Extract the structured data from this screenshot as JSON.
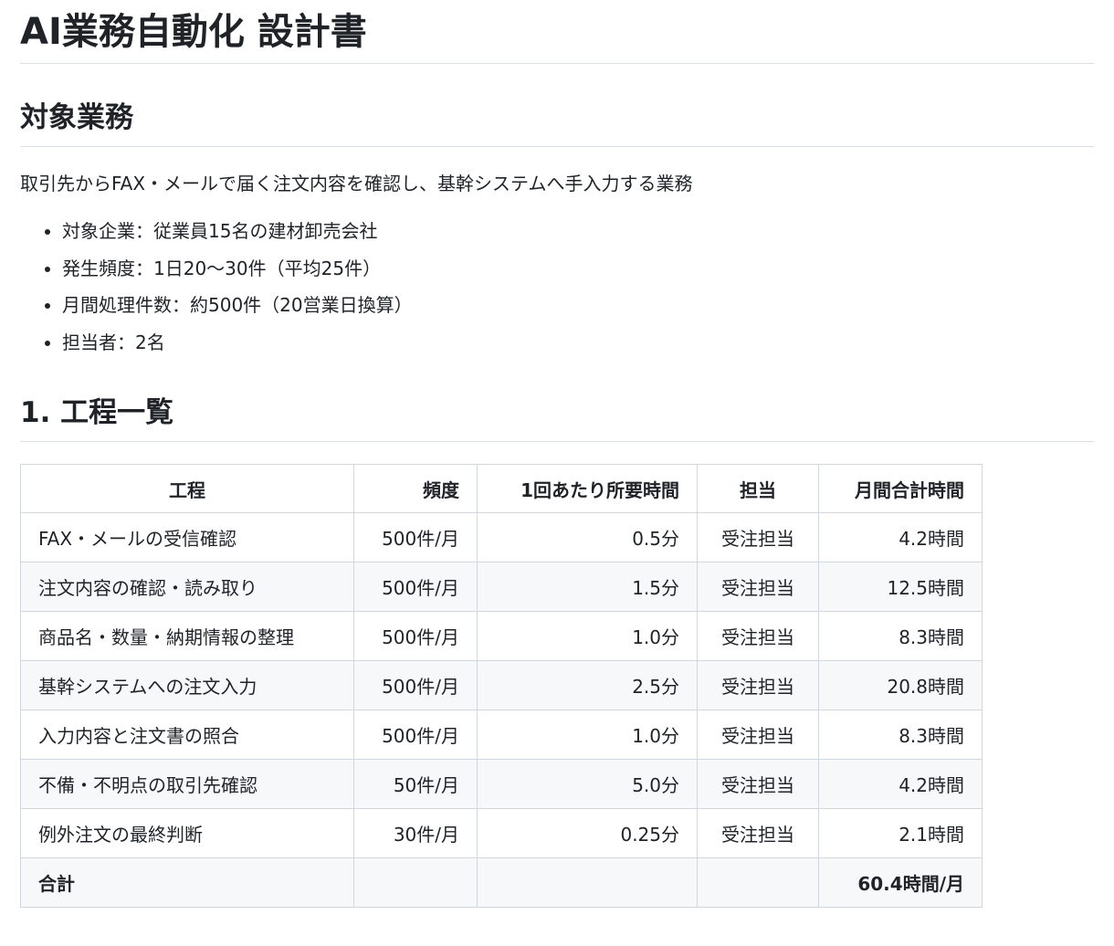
{
  "document": {
    "title": "AI業務自動化 設計書",
    "section_target": {
      "heading": "対象業務",
      "description": "取引先からFAX・メールで届く注文内容を確認し、基幹システムへ手入力する業務",
      "bullets": [
        "対象企業：従業員15名の建材卸売会社",
        "発生頻度：1日20〜30件（平均25件）",
        "月間処理件数：約500件（20営業日換算）",
        "担当者：2名"
      ]
    },
    "section_process": {
      "heading": "1. 工程一覧",
      "table": {
        "headers": [
          "工程",
          "頻度",
          "1回あたり所要時間",
          "担当",
          "月間合計時間"
        ],
        "rows": [
          [
            "FAX・メールの受信確認",
            "500件/月",
            "0.5分",
            "受注担当",
            "4.2時間"
          ],
          [
            "注文内容の確認・読み取り",
            "500件/月",
            "1.5分",
            "受注担当",
            "12.5時間"
          ],
          [
            "商品名・数量・納期情報の整理",
            "500件/月",
            "1.0分",
            "受注担当",
            "8.3時間"
          ],
          [
            "基幹システムへの注文入力",
            "500件/月",
            "2.5分",
            "受注担当",
            "20.8時間"
          ],
          [
            "入力内容と注文書の照合",
            "500件/月",
            "1.0分",
            "受注担当",
            "8.3時間"
          ],
          [
            "不備・不明点の取引先確認",
            "50件/月",
            "5.0分",
            "受注担当",
            "4.2時間"
          ],
          [
            "例外注文の最終判断",
            "30件/月",
            "0.25分",
            "受注担当",
            "2.1時間"
          ]
        ],
        "total": [
          "合計",
          "",
          "",
          "",
          "60.4時間/月"
        ]
      }
    }
  }
}
